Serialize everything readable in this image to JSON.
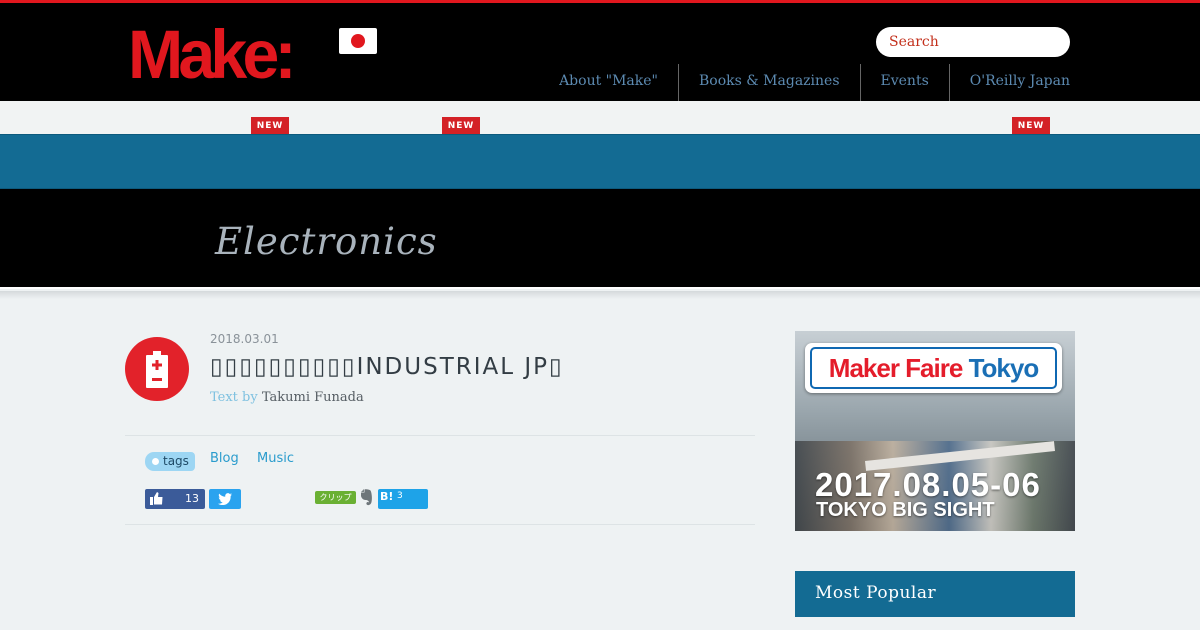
{
  "header": {
    "logo_text": "Make:",
    "flag": "japan-flag",
    "search_placeholder": "Search",
    "nav": [
      "About \"Make\"",
      "Books & Magazines",
      "Events",
      "O'Reilly Japan"
    ],
    "new_badge": "NEW"
  },
  "category": {
    "title": "Electronics"
  },
  "article": {
    "date": "2018.03.01",
    "title": "▯▯▯▯▯▯▯▯▯▯INDUSTRIAL JP▯",
    "byline_label": "Text by",
    "author": "Takumi Funada",
    "tags_label": "tags",
    "tags": [
      "Blog",
      "Music"
    ],
    "facebook_count": "13",
    "clip_label": "クリップ",
    "hatena_label": "B!",
    "hatena_count": "3"
  },
  "sidebar": {
    "ad": {
      "brand_make": "Maker Faire",
      "brand_city": "Tokyo",
      "dates": "2017.08.05-06",
      "venue": "TOKYO BIG SIGHT"
    },
    "most_popular": "Most Popular"
  },
  "colors": {
    "brand_red": "#e1171e",
    "band_blue": "#136b93",
    "link_blue": "#2a9ccd"
  }
}
